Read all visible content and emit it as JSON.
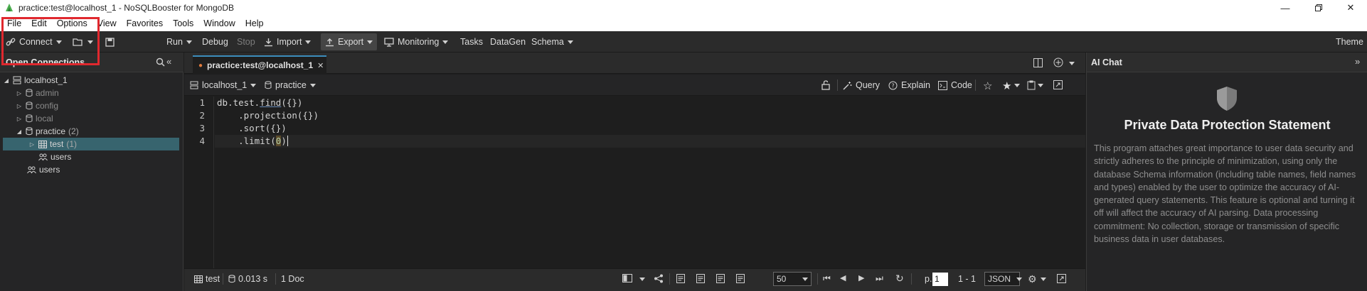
{
  "window": {
    "title": "practice:test@localhost_1 - NoSQLBooster for MongoDB",
    "controls": [
      "minimize",
      "maximize",
      "close"
    ]
  },
  "menu": [
    "File",
    "Edit",
    "Options",
    "View",
    "Favorites",
    "Tools",
    "Window",
    "Help"
  ],
  "toolbar": {
    "connect": "Connect",
    "run": "Run",
    "debug": "Debug",
    "stop": "Stop",
    "import": "Import",
    "export": "Export",
    "monitoring": "Monitoring",
    "tasks": "Tasks",
    "datagen": "DataGen",
    "schema": "Schema",
    "theme": "Theme"
  },
  "left_panel": {
    "title": "Open Connections",
    "tree": {
      "server": "localhost_1",
      "db_admin": "admin",
      "db_config": "config",
      "db_local": "local",
      "db_practice": "practice",
      "db_practice_count": "(2)",
      "collection_test": "test",
      "collection_test_count": "(1)",
      "item_users_1": "users",
      "item_users_2": "users"
    }
  },
  "editor": {
    "tab_label": "practice:test@localhost_1",
    "connection_select": "localhost_1",
    "database_select": "practice",
    "query_label": "Query",
    "explain_label": "Explain",
    "code_label": "Code",
    "code": {
      "l1_a": "db.test.",
      "l1_fn": "find",
      "l1_b": "({})",
      "l2": "    .projection({})",
      "l3": "    .sort({})",
      "l4_a": "    .limit(",
      "l4_num": "0",
      "l4_b": ")"
    },
    "line_numbers": [
      "1",
      "2",
      "3",
      "4"
    ]
  },
  "status": {
    "collection": "test",
    "time": "0.013 s",
    "docs": "1 Doc",
    "page_size": "50",
    "page_prefix": "p.",
    "page_value": "1",
    "range": "1 - 1",
    "format": "JSON"
  },
  "ai_panel": {
    "title": "AI Chat",
    "heading": "Private Data Protection Statement",
    "body": "This program attaches great importance to user data security and strictly adheres to the principle of minimization, using only the database Schema information (including table names, field names and types) enabled by the user to optimize the accuracy of AI-generated query statements. This feature is optional and turning it off will affect the accuracy of AI parsing. Data processing commitment: No collection, storage or transmission of specific business data in user databases."
  },
  "colors": {
    "accent": "#3c8dbc",
    "highlight_box": "#e0282e",
    "selection": "#37646e",
    "background": "#1e1e1e"
  }
}
